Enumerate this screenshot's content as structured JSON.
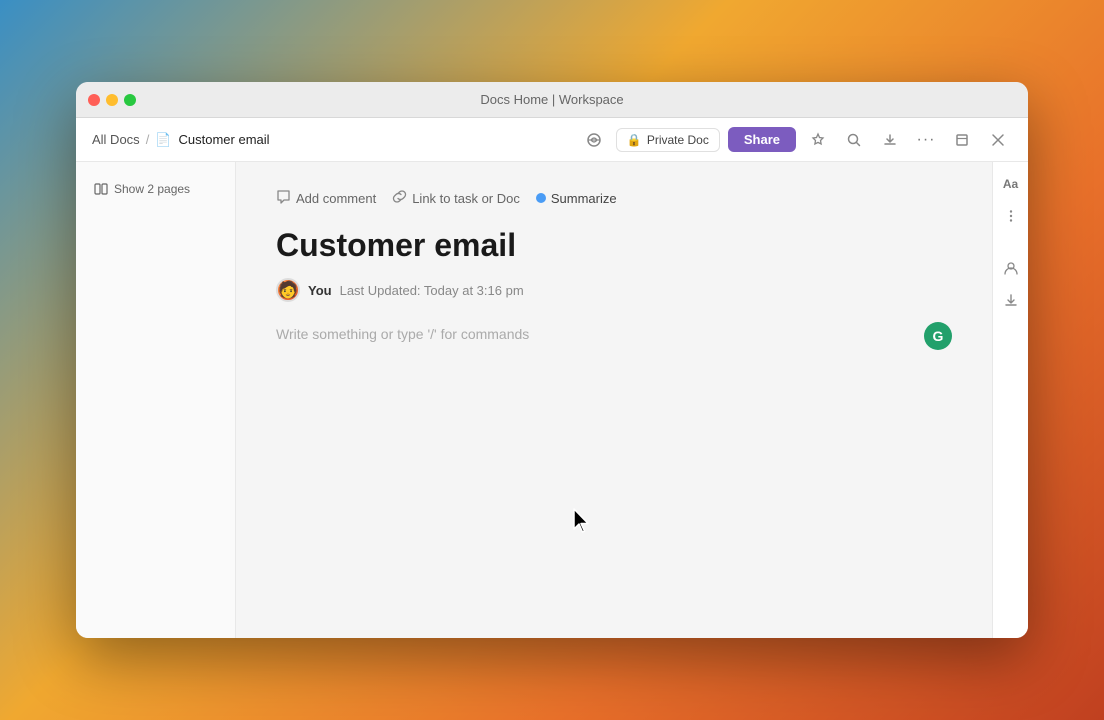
{
  "window": {
    "title": "Docs Home | Workspace"
  },
  "breadcrumb": {
    "all_docs": "All Docs",
    "separator": "/",
    "current": "Customer email",
    "doc_icon": "📄"
  },
  "toolbar": {
    "private_doc_label": "Private Doc",
    "share_label": "Share"
  },
  "sidebar": {
    "show_pages_label": "Show 2 pages",
    "pages_icon": "⊞"
  },
  "doc_actions": {
    "add_comment_label": "Add comment",
    "link_task_label": "Link to task or Doc",
    "summarize_label": "Summarize"
  },
  "document": {
    "title": "Customer email",
    "author": "You",
    "last_updated": "Last Updated: Today at 3:16 pm",
    "placeholder": "Write something or type '/' for commands"
  },
  "right_sidebar": {
    "icons": [
      "Aa",
      "⋮",
      "👤",
      "⬇"
    ]
  },
  "colors": {
    "share_btn": "#7c5cbf",
    "summarize_dot": "#4a9cf5",
    "ai_icon": "#22a06b"
  }
}
